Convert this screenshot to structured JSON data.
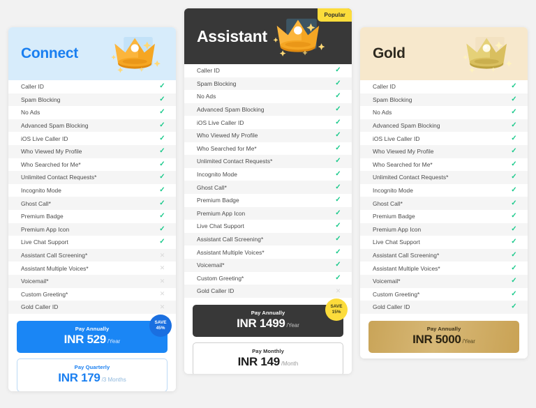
{
  "page": {
    "background": "#f2f2f2",
    "title": "Subscription plan comparison"
  },
  "features": [
    "Caller ID",
    "Spam Blocking",
    "No Ads",
    "Advanced Spam Blocking",
    "iOS Live Caller ID",
    "Who Viewed My Profile",
    "Who Searched for Me*",
    "Unlimited Contact Requests*",
    "Incognito Mode",
    "Ghost Call*",
    "Premium Badge",
    "Premium App Icon",
    "Live Chat Support",
    "Assistant Call Screening*",
    "Assistant Multiple Voices*",
    "Voicemail*",
    "Custom Greeting*",
    "Gold Caller ID"
  ],
  "icons": {
    "included": "✓",
    "excluded": "✕",
    "crown": "crown-icon"
  },
  "plans": [
    {
      "id": "connect",
      "name": "Connect",
      "accent_color": "#1a7ff0",
      "header_bg": "#d7ecfb",
      "badge": null,
      "availability": [
        true,
        true,
        true,
        true,
        true,
        true,
        true,
        true,
        true,
        true,
        true,
        true,
        true,
        false,
        false,
        false,
        false,
        false
      ],
      "prices": [
        {
          "period_label": "Pay Annually",
          "amount": "INR 529",
          "unit": "/Year",
          "style": "primary-blue",
          "save": {
            "word": "SAVE",
            "percent": "45%",
            "style": "blue"
          }
        },
        {
          "period_label": "Pay Quarterly",
          "amount": "INR 179",
          "unit": "/3 Months",
          "style": "outline-blue",
          "save": null
        }
      ]
    },
    {
      "id": "assistant",
      "name": "Assistant",
      "accent_color": "#383838",
      "header_bg": "#383838",
      "badge": "Popular",
      "availability": [
        true,
        true,
        true,
        true,
        true,
        true,
        true,
        true,
        true,
        true,
        true,
        true,
        true,
        true,
        true,
        true,
        true,
        false
      ],
      "prices": [
        {
          "period_label": "Pay Annually",
          "amount": "INR 1499",
          "unit": "/Year",
          "style": "primary-dark",
          "save": {
            "word": "SAVE",
            "percent": "15%",
            "style": "yellow"
          }
        },
        {
          "period_label": "Pay Monthly",
          "amount": "INR 149",
          "unit": "/Month",
          "style": "outline-dark",
          "save": null
        }
      ]
    },
    {
      "id": "gold",
      "name": "Gold",
      "accent_color": "#c9a458",
      "header_bg": "#f7e8cc",
      "badge": null,
      "availability": [
        true,
        true,
        true,
        true,
        true,
        true,
        true,
        true,
        true,
        true,
        true,
        true,
        true,
        true,
        true,
        true,
        true,
        true
      ],
      "prices": [
        {
          "period_label": "Pay Annually",
          "amount": "INR 5000",
          "unit": "/Year",
          "style": "primary-gold",
          "save": null
        }
      ]
    }
  ]
}
